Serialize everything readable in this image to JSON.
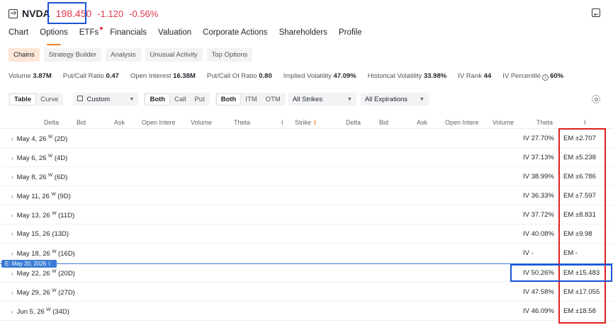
{
  "header": {
    "ticker": "NVDA",
    "price": "198.450",
    "change": "-1.120",
    "change_pct": "-0.56%"
  },
  "nav": {
    "tabs": [
      "Chart",
      "Options",
      "ETFs",
      "Financials",
      "Valuation",
      "Corporate Actions",
      "Shareholders",
      "Profile"
    ],
    "active": "Options"
  },
  "subtabs": [
    "Chains",
    "Strategy Builder",
    "Analysis",
    "Unusual Activity",
    "Top Options"
  ],
  "stats": [
    {
      "label": "Volume",
      "value": "3.87M"
    },
    {
      "label": "Put/Call Ratio",
      "value": "0.47"
    },
    {
      "label": "Open Interest",
      "value": "16.38M"
    },
    {
      "label": "Put/Call OI Ratio",
      "value": "0.80"
    },
    {
      "label": "Implied Volatility",
      "value": "47.09%"
    },
    {
      "label": "Historical Volatility",
      "value": "33.98%"
    },
    {
      "label": "IV Rank",
      "value": "44"
    },
    {
      "label": "IV Percentile",
      "value": "60%"
    }
  ],
  "filters": {
    "view": [
      "Table",
      "Curve"
    ],
    "custom": "Custom",
    "side": [
      "Both",
      "Call",
      "Put"
    ],
    "moneyness": [
      "Both",
      "ITM",
      "OTM"
    ],
    "strikes": "All Strikes",
    "expirations": "All Expirations"
  },
  "columns": {
    "calls": [
      "Delta",
      "Bid",
      "Ask",
      "Open Intere",
      "Volume",
      "Theta",
      "I"
    ],
    "strike": "Strike",
    "puts": [
      "Delta",
      "Bid",
      "Ask",
      "Open Intere",
      "Volume",
      "Theta",
      "I"
    ]
  },
  "earnings_label": "E: May 20, 2026",
  "rows": [
    {
      "date": "May 4, 26",
      "weekly": "W",
      "dte": "(2D)",
      "iv": "IV 27.70%",
      "em": "EM ±2.707"
    },
    {
      "date": "May 6, 26",
      "weekly": "W",
      "dte": "(4D)",
      "iv": "IV 37.13%",
      "em": "EM ±5.238"
    },
    {
      "date": "May 8, 26",
      "weekly": "W",
      "dte": "(6D)",
      "iv": "IV 38.99%",
      "em": "EM ±6.786"
    },
    {
      "date": "May 11, 26",
      "weekly": "W",
      "dte": "(9D)",
      "iv": "IV 36.33%",
      "em": "EM ±7.597"
    },
    {
      "date": "May 13, 26",
      "weekly": "W",
      "dte": "(11D)",
      "iv": "IV 37.72%",
      "em": "EM ±8.831"
    },
    {
      "date": "May 15, 26",
      "weekly": "",
      "dte": "(13D)",
      "iv": "IV 40.08%",
      "em": "EM ±9.98"
    },
    {
      "date": "May 18, 26",
      "weekly": "W",
      "dte": "(16D)",
      "iv": "IV -",
      "em": "EM -"
    },
    {
      "date": "May 22, 26",
      "weekly": "W",
      "dte": "(20D)",
      "iv": "IV 50.26%",
      "em": "EM ±15.483"
    },
    {
      "date": "May 29, 26",
      "weekly": "W",
      "dte": "(27D)",
      "iv": "IV 47.58%",
      "em": "EM ±17.055"
    },
    {
      "date": "Jun 5, 26",
      "weekly": "W",
      "dte": "(34D)",
      "iv": "IV 46.09%",
      "em": "EM ±18.58"
    }
  ],
  "colors": {
    "negative": "#e2364b",
    "accent": "#f0812d",
    "highlight_red": "#e02020",
    "highlight_blue": "#1a54d6"
  }
}
